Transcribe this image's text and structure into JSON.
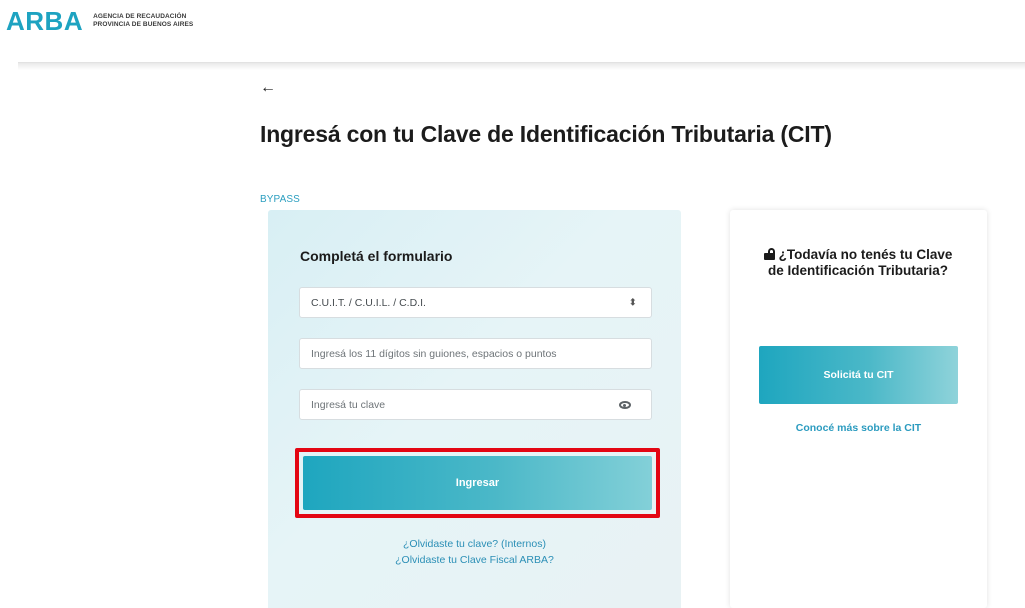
{
  "brand": {
    "logo_text": "ARBA",
    "subtitle_line1": "AGENCIA DE RECAUDACIÓN",
    "subtitle_line2": "PROVINCIA DE BUENOS AIRES"
  },
  "header": {
    "back_icon": "←",
    "title": "Ingresá con tu Clave de Identificación Tributaria (CIT)",
    "bypass_label": "BYPASS"
  },
  "form": {
    "heading": "Completá el formulario",
    "select_value": "C.U.I.T. / C.U.I.L. / C.D.I.",
    "select_icon": "⬍",
    "cuit_placeholder": "Ingresá los 11 dígitos sin guiones, espacios o puntos",
    "password_placeholder": "Ingresá tu clave",
    "submit_label": "Ingresar",
    "forgot_internal": "¿Olvidaste tu clave? (Internos)",
    "forgot_fiscal": "¿Olvidaste tu Clave Fiscal ARBA?"
  },
  "side": {
    "heading": "¿Todavía no tenés tu Clave de Identificación Tributaria?",
    "request_label": "Solicitá tu CIT",
    "more_link": "Conocé más sobre la CIT"
  },
  "colors": {
    "accent": "#1ea6bf",
    "link": "#2b8fb6",
    "highlight": "#e30613",
    "card_bg": "#d8eff4"
  }
}
